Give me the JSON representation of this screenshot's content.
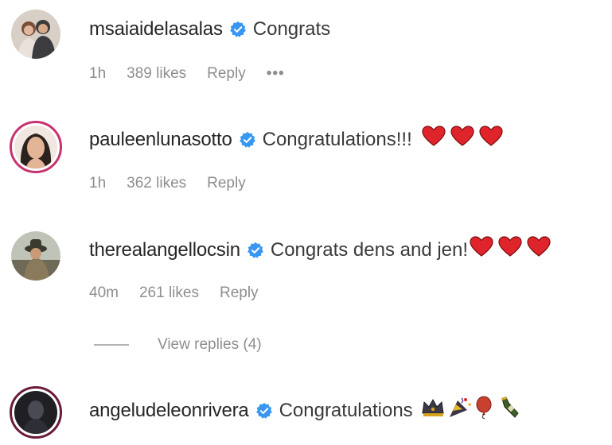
{
  "comments": [
    {
      "username": "msaiaidelasalas",
      "text": "Congrats",
      "time": "1h",
      "likes": "389 likes",
      "reply": "Reply",
      "more": "•••"
    },
    {
      "username": "pauleenlunasotto",
      "text": "Congratulations!!!",
      "time": "1h",
      "likes": "362 likes",
      "reply": "Reply"
    },
    {
      "username": "therealangellocsin",
      "text": "Congrats dens and jen!",
      "time": "40m",
      "likes": "261 likes",
      "reply": "Reply",
      "view_replies": "View replies (4)"
    },
    {
      "username": "angeludeleonrivera",
      "text": "Congratulations"
    }
  ],
  "icons": {
    "verified": "verified-badge-icon",
    "heart": "red-heart-icon",
    "crown": "crown-icon",
    "party": "party-popper-icon",
    "balloon": "balloon-icon",
    "bottle": "champagne-bottle-icon"
  },
  "colors": {
    "verified": "#3897f0",
    "heart": "#e0242b",
    "meta": "#8e8e8e",
    "story_ring": "#c8326e"
  }
}
